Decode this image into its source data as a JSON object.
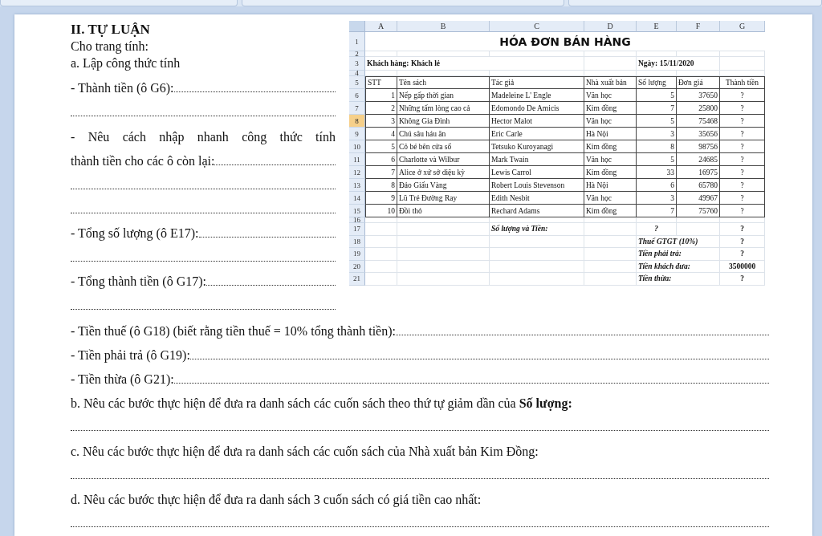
{
  "left_items": [
    {
      "kind": "heading",
      "text": "II. TỰ LUẬN"
    },
    {
      "kind": "text",
      "text": "Cho trang tính:"
    },
    {
      "kind": "text",
      "text": "a. Lập công thức tính"
    },
    {
      "kind": "prompt",
      "text": "- Thành tiền (ô G6):"
    },
    {
      "kind": "blank"
    },
    {
      "kind": "justified",
      "text": "- Nêu cách nhập nhanh công thức tính"
    },
    {
      "kind": "prompt",
      "text": "thành tiền cho các ô còn lại:"
    },
    {
      "kind": "blank"
    },
    {
      "kind": "blank"
    },
    {
      "kind": "prompt",
      "text": "- Tổng số lượng (ô E17): "
    },
    {
      "kind": "blank"
    },
    {
      "kind": "prompt",
      "text": "- Tổng thành tiền (ô G17): "
    },
    {
      "kind": "blank"
    }
  ],
  "sheet": {
    "columns": [
      "A",
      "B",
      "C",
      "D",
      "E",
      "F",
      "G"
    ],
    "rows": [
      {
        "number": "1",
        "selected": false,
        "kind": "title",
        "text": "HÓA ĐƠN BÁN HÀNG"
      },
      {
        "number": "2",
        "selected": false,
        "kind": "blank"
      },
      {
        "number": "3",
        "selected": false,
        "kind": "info",
        "customer": "Khách hàng: Khách lẻ",
        "date": "Ngày: 15/11/2020"
      },
      {
        "number": "4",
        "selected": false,
        "kind": "blank"
      },
      {
        "number": "5",
        "selected": false,
        "kind": "header",
        "cells": [
          "STT",
          "Tên sách",
          "Tác giả",
          "Nhà xuất bản",
          "Số lượng",
          "Đơn giá",
          "Thành tiền"
        ]
      },
      {
        "number": "6",
        "selected": false,
        "kind": "item",
        "cells": [
          "1",
          "Nếp gấp thời gian",
          "Madeleine L' Engle",
          "Văn học",
          "5",
          "37650",
          "?"
        ]
      },
      {
        "number": "7",
        "selected": false,
        "kind": "item",
        "cells": [
          "2",
          "Những tấm lòng cao cả",
          "Edomondo De Amicis",
          "Kim đồng",
          "7",
          "25800",
          "?"
        ]
      },
      {
        "number": "8",
        "selected": true,
        "kind": "item",
        "cells": [
          "3",
          "Không Gia Đình",
          "Hector Malot",
          "Văn học",
          "5",
          "75468",
          "?"
        ]
      },
      {
        "number": "9",
        "selected": false,
        "kind": "item",
        "cells": [
          "4",
          "Chú sâu háu ăn",
          "Eric Carle",
          "Hà Nội",
          "3",
          "35656",
          "?"
        ]
      },
      {
        "number": "10",
        "selected": false,
        "kind": "item",
        "cells": [
          "5",
          "Cô bé bên cửa sổ",
          "Tetsuko Kuroyanagi",
          "Kim đồng",
          "8",
          "98756",
          "?"
        ]
      },
      {
        "number": "11",
        "selected": false,
        "kind": "item",
        "cells": [
          "6",
          "Charlotte và Wilbur",
          "Mark Twain",
          "Văn học",
          "5",
          "24685",
          "?"
        ]
      },
      {
        "number": "12",
        "selected": false,
        "kind": "item",
        "cells": [
          "7",
          "Alice ở xứ sở diệu kỳ",
          "Lewis Carrol",
          "Kim đồng",
          "33",
          "16975",
          "?"
        ]
      },
      {
        "number": "13",
        "selected": false,
        "kind": "item",
        "cells": [
          "8",
          "Đảo Giấu Vàng",
          "Robert Louis Stevenson",
          "Hà Nội",
          "6",
          "65780",
          "?"
        ]
      },
      {
        "number": "14",
        "selected": false,
        "kind": "item",
        "cells": [
          "9",
          "Lũ Trẻ Đường Ray",
          "Edith Nesbit",
          "Văn học",
          "3",
          "49967",
          "?"
        ]
      },
      {
        "number": "15",
        "selected": false,
        "kind": "item",
        "cells": [
          "10",
          "Đồi thỏ",
          "Rechard Adams",
          "Kim đồng",
          "7",
          "75760",
          "?"
        ]
      },
      {
        "number": "16",
        "selected": false,
        "kind": "blank"
      },
      {
        "number": "17",
        "selected": false,
        "kind": "total",
        "caption": "Số lượng và Tiền:",
        "quantity": "?",
        "value": "?"
      },
      {
        "number": "18",
        "selected": false,
        "kind": "summary",
        "label": "Thuế GTGT (10%)",
        "value": "?"
      },
      {
        "number": "19",
        "selected": false,
        "kind": "summary",
        "label": "Tiền phải trả:",
        "value": "?"
      },
      {
        "number": "20",
        "selected": false,
        "kind": "summary",
        "label": "Tiền khách đưa:",
        "value": "3500000"
      },
      {
        "number": "21",
        "selected": false,
        "kind": "summary",
        "label": "Tiền thừa:",
        "value": "?"
      }
    ]
  },
  "bottom_items": [
    {
      "kind": "prompt",
      "text": "- Tiền thuế (ô G18) (biết rằng tiền thuế = 10% tổng thành tiền): "
    },
    {
      "kind": "prompt",
      "text": "- Tiền phải trả (ô G19):"
    },
    {
      "kind": "prompt",
      "text": "- Tiền thừa (ô G21):"
    },
    {
      "kind": "text",
      "text": "b. Nêu các bước thực hiện để đưa ra danh sách các cuốn sách theo thứ tự giảm  dần của **Số lượng:**"
    },
    {
      "kind": "blank"
    },
    {
      "kind": "text",
      "text": "c. Nêu các bước thực hiện để đưa ra danh sách các cuốn sách của Nhà xuất bản Kim Đồng:"
    },
    {
      "kind": "blank"
    },
    {
      "kind": "text",
      "text": "d. Nêu các bước thực hiện để đưa ra danh sách 3 cuốn sách có giá tiền cao nhất:"
    },
    {
      "kind": "blank"
    }
  ]
}
